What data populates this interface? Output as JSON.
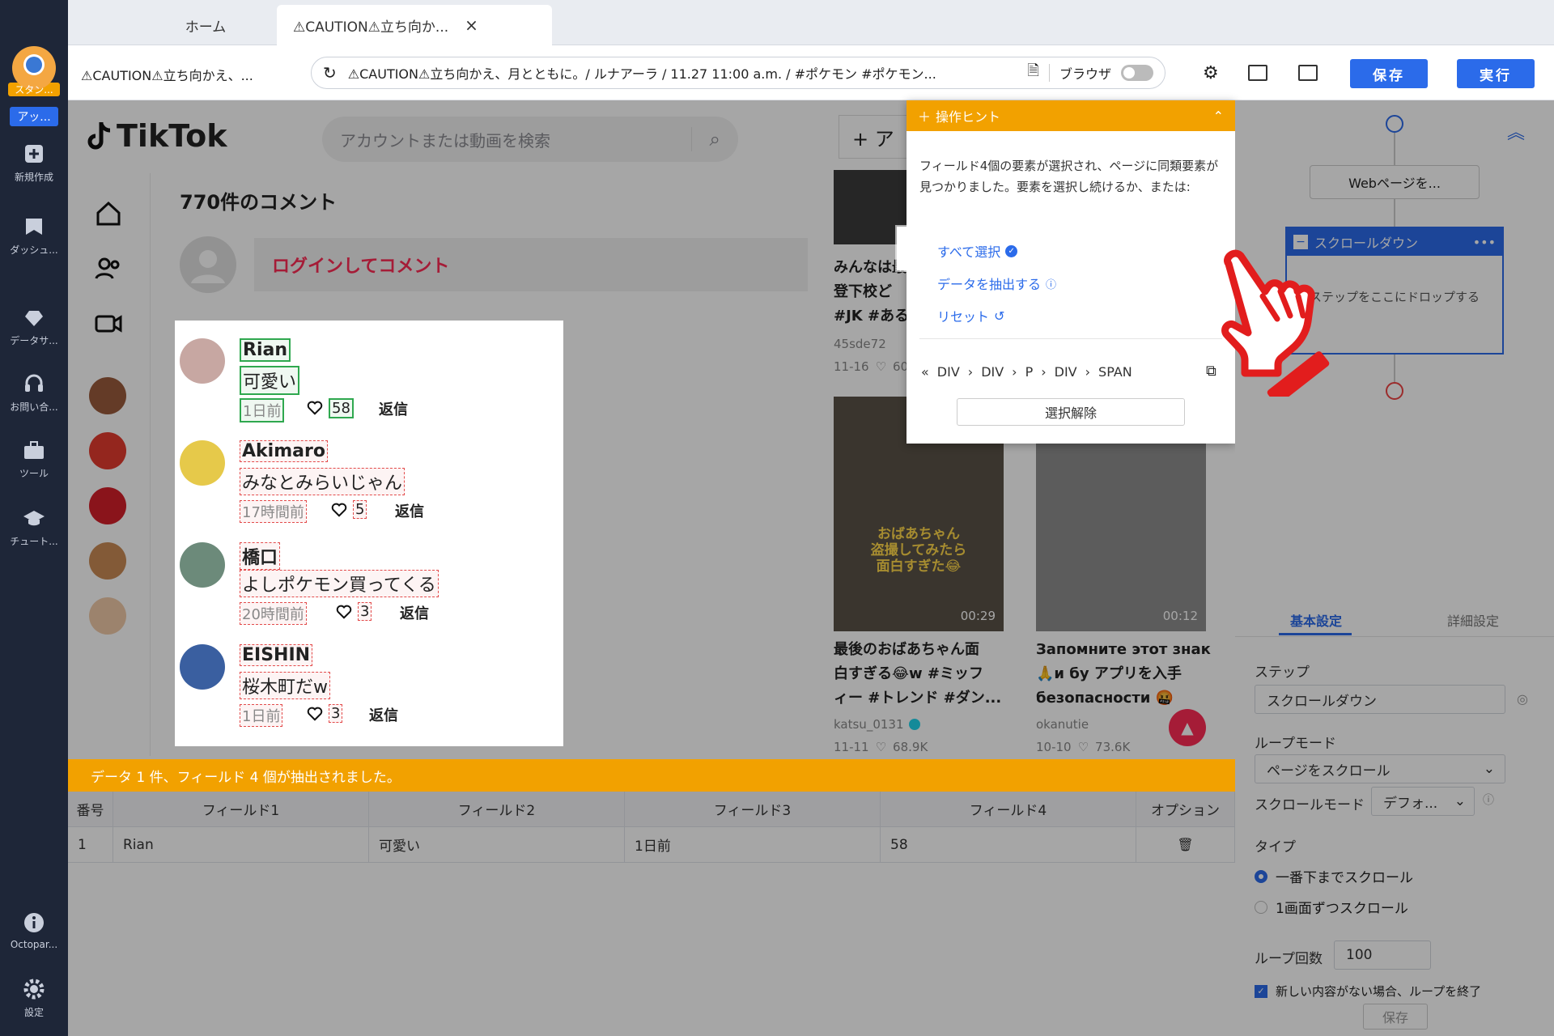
{
  "nav": {
    "items": [
      {
        "label": "スタン...",
        "icon": "user-avatar-icon"
      },
      {
        "label": "アッ...",
        "icon": "upgrade-badge"
      },
      {
        "label": "新規作成",
        "icon": "plus-square-icon"
      },
      {
        "label": "ダッシュ...",
        "icon": "dashboard-icon"
      },
      {
        "label": "データサ...",
        "icon": "data-service-icon"
      },
      {
        "label": "お問い合...",
        "icon": "headset-icon"
      },
      {
        "label": "ツール",
        "icon": "toolbox-icon"
      },
      {
        "label": "チュート...",
        "icon": "graduation-cap-icon"
      },
      {
        "label": "Octopar...",
        "icon": "info-icon"
      },
      {
        "label": "設定",
        "icon": "gear-icon"
      }
    ]
  },
  "tabs": [
    {
      "label": "ホーム"
    },
    {
      "label": "⚠CAUTION⚠立ち向か..."
    }
  ],
  "address": {
    "page_title": "⚠CAUTION⚠立ち向かえ、...",
    "url": "⚠CAUTION⚠立ち向かえ、月とともに。/ ルナアーラ / 11.27 11:00 a.m. / #ポケモン #ポケモン...",
    "browser_label": "ブラウザ",
    "save_label": "保存",
    "run_label": "実行"
  },
  "tiktok": {
    "logo_text": "TikTok",
    "search_placeholder": "アカウントまたは動画を検索",
    "upload_label": "+ ア",
    "comments_title": "770件のコメント",
    "login_prompt": "ログインしてコメント",
    "comments": [
      {
        "user": "Rian",
        "text": "可愛い",
        "time": "1日前",
        "likes": "58",
        "reply": "返信"
      },
      {
        "user": "Akimaro",
        "text": "みなとみらいじゃん",
        "time": "17時間前",
        "likes": "5",
        "reply": "返信"
      },
      {
        "user": "橋口",
        "text": "よしポケモン買ってくる",
        "time": "20時間前",
        "likes": "3",
        "reply": "返信"
      },
      {
        "user": "EISHIN",
        "text": "桜木町だw",
        "time": "1日前",
        "likes": "3",
        "reply": "返信"
      }
    ],
    "videos": [
      {
        "title_lines": [
          "みんなは最",
          "登下校ど",
          "#JK #ある"
        ],
        "author": "45sde72",
        "date": "11-16",
        "likes": "60"
      },
      {
        "overlay": "おばあちゃん\n盗撮してみたら\n面白すぎた😂",
        "duration": "00:29",
        "title_lines": [
          "最後のおばあちゃん面",
          "白すぎる😂w #ミッフ",
          "ィー #トレンド #ダン..."
        ],
        "author": "katsu_0131",
        "date": "11-11",
        "likes": "68.9K"
      },
      {
        "duration": "00:12",
        "title_lines": [
          "Запомните этот знак",
          "🙏и бу アプリを入手",
          "безопасности 🤬"
        ],
        "author": "okanutie",
        "date": "10-10",
        "likes": "73.6K"
      }
    ]
  },
  "hint": {
    "header": "操作ヒント",
    "message": "フィールド4個の要素が選択され、ページに同類要素が見つかりました。要素を選択し続けるか、または:",
    "select_all": "すべて選択",
    "extract": "データを抽出する",
    "reset": "リセット",
    "path": [
      "DIV",
      "DIV",
      "P",
      "DIV",
      "SPAN"
    ],
    "deselect": "選択解除"
  },
  "flow": {
    "open_page": "Webページを...",
    "scroll_step": "スクロールダウン",
    "drop_hint": "ステップをここにドロップする"
  },
  "settings": {
    "tab_basic": "基本設定",
    "tab_detail": "詳細設定",
    "step_label": "ステップ",
    "step_value": "スクロールダウン",
    "loop_mode_label": "ループモード",
    "loop_mode_value": "ページをスクロール",
    "scroll_mode_label": "スクロールモード",
    "scroll_mode_value": "デフォ...",
    "type_label": "タイプ",
    "type_option1": "一番下までスクロール",
    "type_option2": "1画面ずつスクロール",
    "loop_count_label": "ループ回数",
    "loop_count_value": "100",
    "checkbox_label": "新しい内容がない場合、ループを終了",
    "save": "保存"
  },
  "databar": {
    "message": "データ 1 件、フィールド 4 個が抽出されました。"
  },
  "table": {
    "headers": [
      "番号",
      "フィールド1",
      "フィールド2",
      "フィールド3",
      "フィールド4",
      "オプション"
    ],
    "rows": [
      [
        "1",
        "Rian",
        "可愛い",
        "1日前",
        "58"
      ]
    ]
  },
  "colors": {
    "accent": "#2b6bea",
    "warning": "#f2a100",
    "tiktok_red": "#fe2c55",
    "sidebar": "#1e2638"
  }
}
